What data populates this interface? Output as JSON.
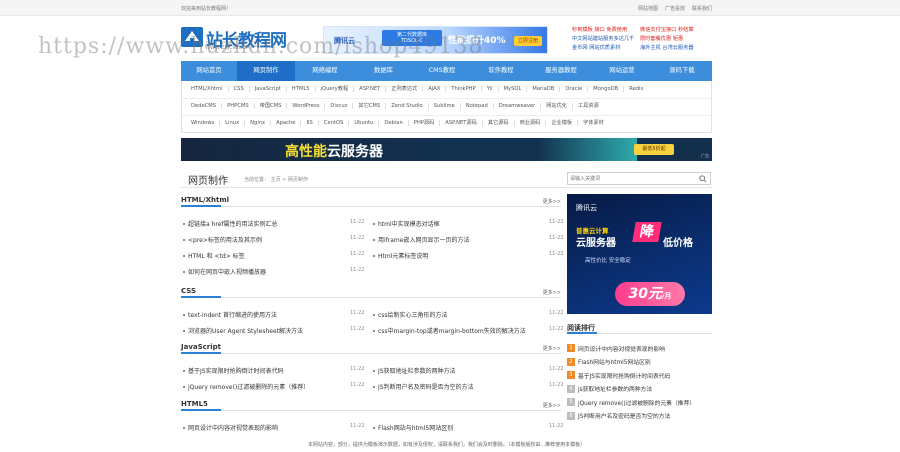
{
  "topbar": {
    "welcome": "欢迎来到站长教程网！",
    "links": [
      "网站地图",
      "广告投放",
      "联系我们"
    ]
  },
  "header": {
    "logo_text": "站长教程网",
    "logo_sub": "WWW.ZZJCW.COM"
  },
  "watermark": "https://www.huzhan.com/ishop49138",
  "banner1": {
    "brand": "腾讯云",
    "badge_line1": "第二代数据库",
    "badge_line2": "TDSQL-C",
    "main_text": "性能提升40%",
    "button": "立即注册"
  },
  "promos": [
    {
      "text": "秒到模板 接口 免费使用",
      "color": "r"
    },
    {
      "text": "微信支付宝接口 秒结算",
      "color": "r"
    },
    {
      "text": "中文网站建站服务多达几千",
      "color": "b"
    },
    {
      "text": "限时套餐优惠 钜惠",
      "color": "r"
    },
    {
      "text": "金币网 网站优质素材",
      "color": "b"
    },
    {
      "text": "海外主机 台湾云服务器",
      "color": "b"
    }
  ],
  "nav": [
    "网站首页",
    "网页制作",
    "网络编程",
    "数据库",
    "CMS教程",
    "软件教程",
    "服务器教程",
    "网站运营",
    "源码下载"
  ],
  "nav_active": 1,
  "tags": [
    [
      "HTML/Xhtml",
      "CSS",
      "JavaScript",
      "HTML5",
      "jQuery教程",
      "ASP.NET",
      "正则表达式",
      "AJAX",
      "ThinkPHP",
      "Yii",
      "MySQL",
      "MariaDB",
      "Oracle",
      "MongoDB",
      "Redis"
    ],
    [
      "DedeCMS",
      "PHPCMS",
      "帝国CMS",
      "WordPress",
      "Discuz",
      "其它CMS",
      "Zend Studio",
      "Sublime",
      "Notepad",
      "Dreamweaver",
      "网站优化",
      "工具资源"
    ],
    [
      "Windows",
      "Linux",
      "Nginx",
      "Apache",
      "IIS",
      "CentOS",
      "Ubuntu",
      "Debian",
      "PHP源码",
      "ASP.NET源码",
      "其它源码",
      "商业源码",
      "企业模板",
      "字体素材"
    ]
  ],
  "banner2": {
    "main_highlight": "高性能",
    "main_rest": "云服务器",
    "button": "最低5折起",
    "ad_label": "广告"
  },
  "section": {
    "title": "网页制作",
    "breadcrumb": "当前位置： 主页 > 网页制作",
    "search_placeholder": "请输入关键词"
  },
  "blocks": [
    {
      "title": "HTML/Xhtml",
      "more": "更多>>",
      "left": [
        {
          "title": "超链接a href属性的用法实例汇总",
          "date": "11-22"
        },
        {
          "title": "&lt;pre&gt;标签的用法及其示例",
          "date": "11-22"
        },
        {
          "title": "HTML 和 &lt;td&gt; 标签",
          "date": "11-22"
        },
        {
          "title": "如何在网页中嵌入视频播放器",
          "date": "11-22"
        }
      ],
      "right": [
        {
          "title": "html中实现模态对话框",
          "date": "11-22"
        },
        {
          "title": "用iframe嵌入网页显示一页的方法",
          "date": "11-22"
        },
        {
          "title": "Html元素标签说明",
          "date": "11-22"
        }
      ]
    },
    {
      "title": "CSS",
      "more": "更多>>",
      "left": [
        {
          "title": "text-indent 首行缩进的使用方法",
          "date": "11-22"
        },
        {
          "title": "浏览器的User Agent Stylesheet解决方法",
          "date": "11-22"
        }
      ],
      "right": [
        {
          "title": "css绘制实心三角形的方法",
          "date": "11-22"
        },
        {
          "title": "css中margin-top或者margin-bottom失效的解决方法",
          "date": "11-22"
        }
      ]
    },
    {
      "title": "JavaScript",
      "more": "更多>>",
      "left": [
        {
          "title": "基于JS实现限时抢购倒计时间表代码",
          "date": "11-22"
        },
        {
          "title": "jQuery remove()过滤被删除的元素（推荐）",
          "date": "11-22"
        }
      ],
      "right": [
        {
          "title": "JS获取地址栏参数的两种方法",
          "date": "11-22"
        },
        {
          "title": "JS判断用户名及密码是否为空的方法",
          "date": "11-22"
        }
      ]
    },
    {
      "title": "HTML5",
      "more": "更多>>",
      "left": [
        {
          "title": "网页设计中内容对视觉表现的影响",
          "date": "11-22"
        }
      ],
      "right": [
        {
          "title": "Flash网站与html5网站区别",
          "date": "11-22"
        }
      ]
    }
  ],
  "side_ad": {
    "brand": "腾讯云",
    "line1": "普惠云计算",
    "line2": "云服务器",
    "highlight": "降",
    "line2b": "低价格",
    "line3": "高性价比 安全稳定",
    "price": "30元",
    "unit": "/月"
  },
  "rank": {
    "title": "阅读排行",
    "items": [
      "网页设计中内容对视觉表现的影响",
      "Flash网站与html5网站区别",
      "基于JS实现限时抢购倒计时间表代码",
      "js获取地址栏参数的两种方法",
      "jQuery remove()过滤被删除的元素（推荐）",
      "JS判断用户名及密码是否为空的方法"
    ]
  },
  "footer": "本网站内容，部分，提供为模板演示数据，如有涉及侵权，请联系我们，我们会及时删除。（本模板版权由...推荐使用本模板）"
}
